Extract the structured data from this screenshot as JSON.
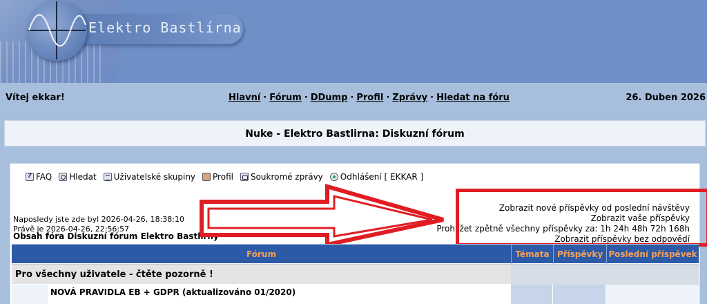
{
  "site": {
    "logo_text": "Elektro Bastlírna"
  },
  "nav": {
    "welcome": "Vítej ekkar!",
    "links": [
      "Hlavní",
      "Fórum",
      "DDump",
      "Profil",
      "Zprávy",
      "Hledat na fóru"
    ],
    "date": "26. Duben 2026"
  },
  "page_title": "Nuke - Elektro Bastlirna: Diskuzní fórum",
  "toolbar": {
    "faq": "FAQ",
    "search": "Hledat",
    "groups": "Uživatelské skupiny",
    "profile": "Profil",
    "messages": "Soukromé zprávy",
    "logout": "Odhlášení [ EKKAR ]"
  },
  "visit": {
    "last_visit": "Naposledy jste zde byl 2026-04-26, 18:38:10",
    "now": "Právě je 2026-04-26, 22:56:57"
  },
  "board_title": "Obsah fóra Diskuzní fórum Elektro Bastlírny",
  "quick_links": {
    "new_posts": "Zobrazit nové příspěvky od poslední návštěvy",
    "your_posts": "Zobrazit vaše příspěvky",
    "browse_label": "Prohlížet zpětně všechny příspěvky za:",
    "periods": [
      "1h",
      "24h",
      "48h",
      "72h",
      "168h"
    ],
    "unanswered": "Zobrazit příspěvky bez odpovědí"
  },
  "table": {
    "headers": {
      "forum": "Fórum",
      "topics": "Témata",
      "posts": "Příspěvky",
      "last_post": "Poslední příspěvek"
    },
    "category": "Pro všechny uživatele - čtěte pozorně !",
    "rows": [
      {
        "name": "NOVÁ PRAVIDLA EB + GDPR (aktualizováno 01/2020)"
      }
    ]
  },
  "colors": {
    "accent_red": "#e11d24",
    "header_blue": "#2d5aa7",
    "header_text": "#f3a15a",
    "page_bg": "#a7bfdc"
  }
}
